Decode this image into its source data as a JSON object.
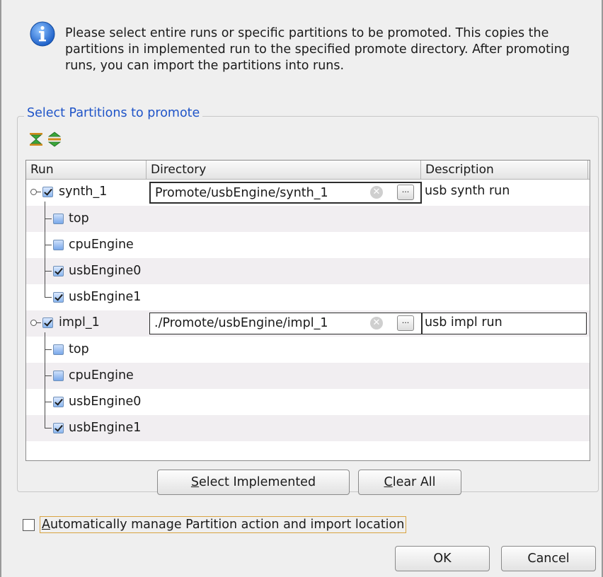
{
  "dialog": {
    "info_message": "Please select entire runs or specific partitions to be promoted. This copies the partitions in implemented run to the specified promote directory. After promoting runs, you can import the partitions into runs."
  },
  "partitions_group": {
    "title": "Select Partitions to promote",
    "toolbar_icons": [
      "collapse-all-icon",
      "expand-all-icon"
    ]
  },
  "table": {
    "columns": [
      "Run",
      "Directory",
      "Description"
    ],
    "runs": [
      {
        "name": "synth_1",
        "checked": true,
        "directory": "Promote/usbEngine/synth_1",
        "description": "usb synth run",
        "partitions": [
          {
            "name": "top",
            "checked": false
          },
          {
            "name": "cpuEngine",
            "checked": false
          },
          {
            "name": "usbEngine0",
            "checked": true
          },
          {
            "name": "usbEngine1",
            "checked": true
          }
        ]
      },
      {
        "name": "impl_1",
        "checked": true,
        "directory": "./Promote/usbEngine/impl_1",
        "description": "usb impl run",
        "partitions": [
          {
            "name": "top",
            "checked": false
          },
          {
            "name": "cpuEngine",
            "checked": false
          },
          {
            "name": "usbEngine0",
            "checked": true
          },
          {
            "name": "usbEngine1",
            "checked": true
          }
        ]
      }
    ],
    "browse_label": "..."
  },
  "buttons": {
    "select_implemented_mnemonic": "S",
    "select_implemented_rest": "elect Implemented",
    "clear_all_mnemonic": "C",
    "clear_all_rest": "lear All",
    "ok": "OK",
    "cancel": "Cancel"
  },
  "auto_manage": {
    "checked": false,
    "mnemonic": "A",
    "label_rest": "utomatically manage Partition action and import location"
  }
}
